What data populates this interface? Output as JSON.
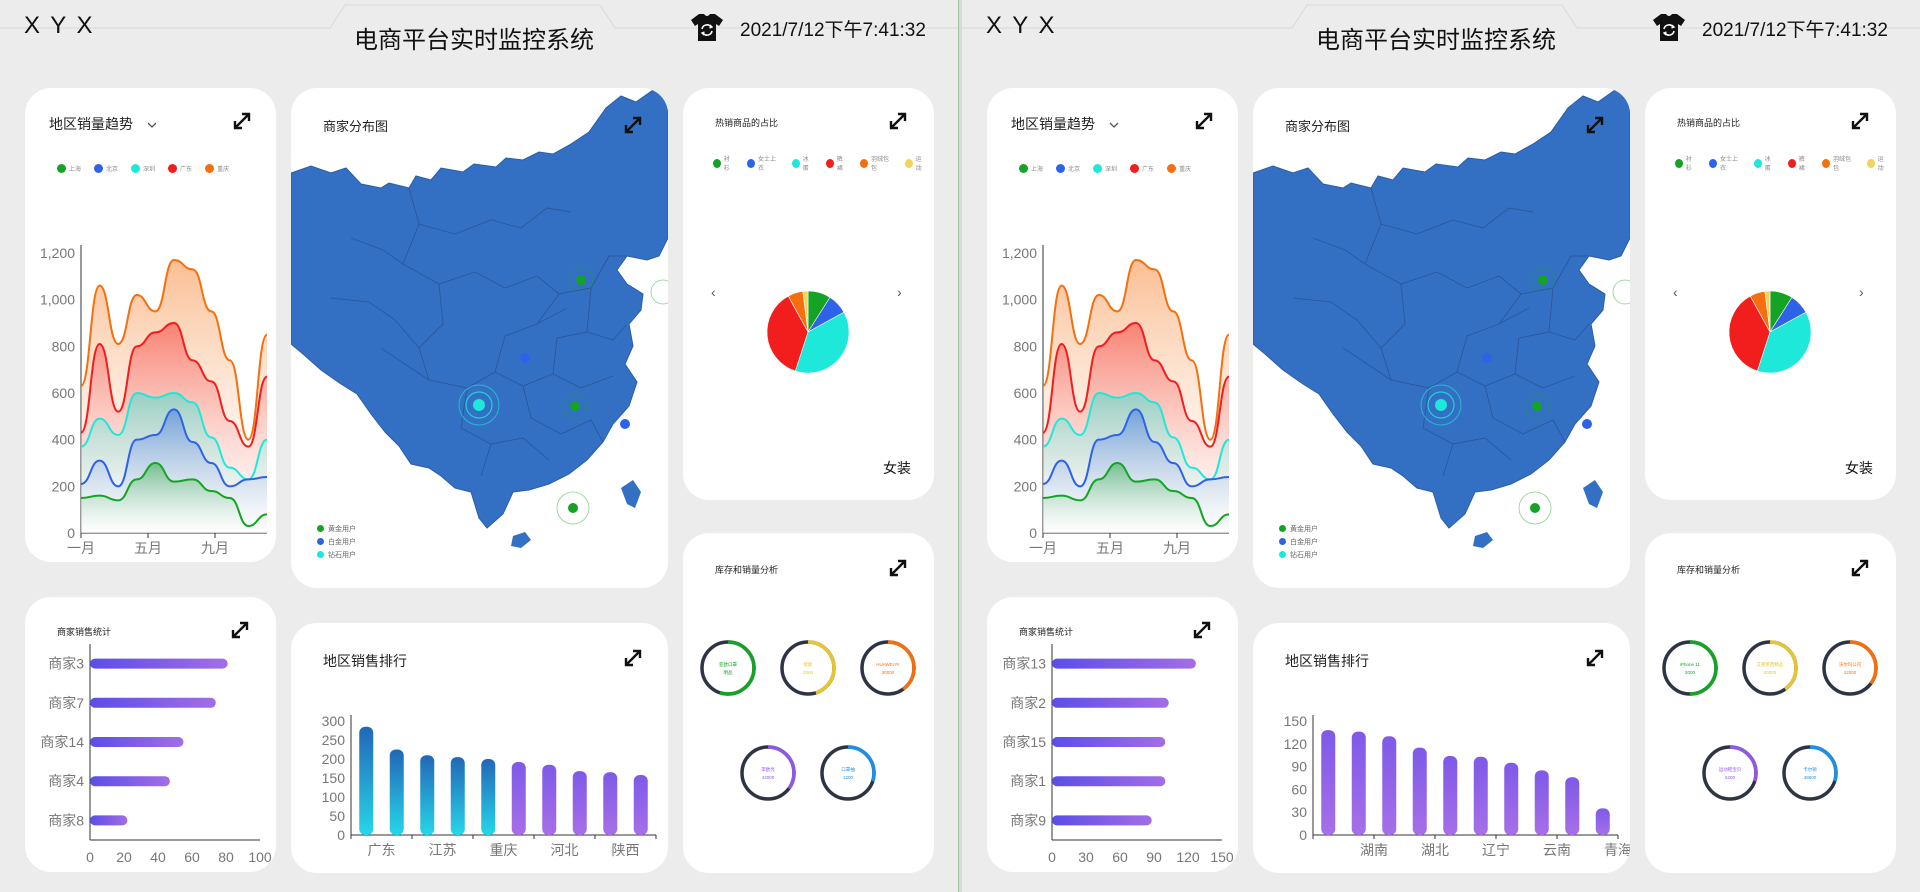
{
  "colors": {
    "green": "#14a324",
    "blue": "#2d62e9",
    "cyan": "#1ee8da",
    "red": "#f21d1d",
    "orange": "#f56f0f",
    "yellow": "#f2d35d",
    "map": "#3370c4"
  },
  "panels": [
    {
      "header": {
        "logo": "X Y X",
        "title": "电商平台实时监控系统",
        "time": "2021/7/12下午7:41:32"
      },
      "trend": {
        "title": "地区销量趋势",
        "legend": [
          "上海",
          "北京",
          "深圳",
          "广东",
          "重庆"
        ],
        "chart_data": {
          "type": "area",
          "y_ticks": [
            "1,200",
            "1,000",
            "800",
            "600",
            "400",
            "200",
            "0"
          ],
          "x_ticks": [
            "一月",
            "五月",
            "九月"
          ],
          "ylim": [
            0,
            1200
          ],
          "series": [
            {
              "name": "上海",
              "values": [
                150,
                160,
                140,
                230,
                300,
                220,
                230,
                180,
                150,
                30,
                80
              ]
            },
            {
              "name": "北京",
              "values": [
                210,
                310,
                200,
                400,
                420,
                530,
                390,
                300,
                200,
                230,
                240
              ]
            },
            {
              "name": "深圳",
              "values": [
                370,
                490,
                420,
                600,
                580,
                600,
                560,
                410,
                280,
                230,
                400
              ]
            },
            {
              "name": "广东",
              "values": [
                430,
                810,
                520,
                800,
                860,
                900,
                740,
                650,
                480,
                370,
                670
              ]
            },
            {
              "name": "重庆",
              "values": [
                630,
                1060,
                810,
                1020,
                950,
                1170,
                1130,
                950,
                740,
                400,
                850
              ]
            }
          ]
        }
      },
      "merchant_map": {
        "title": "商家分布图",
        "legend": [
          "黄金用户",
          "白金用户",
          "钻石用户"
        ]
      },
      "hot": {
        "title": "热销商品的占比",
        "legend": [
          "衬衫",
          "女士上衣",
          "冰蛋",
          "裤裙",
          "羽绒包包",
          "运动"
        ],
        "caption": "女装",
        "chart_data": {
          "type": "pie",
          "values": [
            {
              "value": 9,
              "color": "#14a324"
            },
            {
              "value": 8,
              "color": "#2d62e9"
            },
            {
              "value": 38,
              "color": "#1ee8da"
            },
            {
              "value": 37,
              "color": "#f21d1d"
            },
            {
              "value": 6,
              "color": "#f56f0f"
            },
            {
              "value": 2,
              "color": "#f2d35d"
            }
          ]
        }
      },
      "merchant_sales": {
        "title": "商家销售统计",
        "chart_data": {
          "type": "bar",
          "categories": [
            "商家3",
            "商家7",
            "商家14",
            "商家4",
            "商家8"
          ],
          "values": [
            81,
            74,
            55,
            47,
            22
          ],
          "x_ticks": [
            "0",
            "20",
            "40",
            "60",
            "80",
            "100"
          ],
          "xlim": [
            0,
            100
          ]
        }
      },
      "region_rank": {
        "title": "地区销售排行",
        "chart_data": {
          "type": "bar",
          "categories": [
            "广东",
            "",
            "江苏",
            "",
            "重庆",
            "",
            "河北",
            "",
            "陕西",
            ""
          ],
          "x_labels": [
            "广东",
            "江苏",
            "重庆",
            "河北",
            "陕西"
          ],
          "values": [
            285,
            225,
            210,
            205,
            200,
            192,
            185,
            168,
            165,
            158
          ],
          "y_ticks": [
            "300",
            "250",
            "200",
            "150",
            "100",
            "50",
            "0"
          ],
          "ylim": [
            0,
            300
          ]
        }
      },
      "stock": {
        "title": "库存和销量分析",
        "rings": [
          {
            "l1": "亚欧口罩",
            "l2": "明品",
            "color": "#14a324",
            "v": 0.55
          },
          {
            "l1": "智能",
            "l2": "2000",
            "color": "#e7c433",
            "v": 0.45
          },
          {
            "l1": "HUAWEI Pr",
            "l2": "30000",
            "color": "#f56f0f",
            "v": 0.4
          },
          {
            "l1": "李欧亮",
            "l2": "42000",
            "color": "#8f58e8",
            "v": 0.35
          },
          {
            "l1": "口罩抽",
            "l2": "1200",
            "color": "#1d8fe8",
            "v": 0.3
          }
        ]
      }
    },
    {
      "header": {
        "logo": "X Y X",
        "title": "电商平台实时监控系统",
        "time": "2021/7/12下午7:41:32"
      },
      "trend": {
        "title": "地区销量趋势",
        "legend": [
          "上海",
          "北京",
          "深圳",
          "广东",
          "重庆"
        ],
        "chart_data": {
          "type": "area",
          "y_ticks": [
            "1,200",
            "1,000",
            "800",
            "600",
            "400",
            "200",
            "0"
          ],
          "x_ticks": [
            "一月",
            "五月",
            "九月"
          ],
          "ylim": [
            0,
            1200
          ],
          "series": [
            {
              "name": "上海",
              "values": [
                150,
                160,
                140,
                230,
                300,
                220,
                230,
                180,
                150,
                30,
                80
              ]
            },
            {
              "name": "北京",
              "values": [
                210,
                310,
                200,
                400,
                420,
                530,
                390,
                300,
                200,
                230,
                240
              ]
            },
            {
              "name": "深圳",
              "values": [
                370,
                490,
                420,
                600,
                580,
                600,
                560,
                410,
                280,
                230,
                400
              ]
            },
            {
              "name": "广东",
              "values": [
                430,
                810,
                520,
                800,
                860,
                900,
                740,
                650,
                480,
                370,
                670
              ]
            },
            {
              "name": "重庆",
              "values": [
                630,
                1060,
                810,
                1020,
                950,
                1170,
                1130,
                950,
                740,
                400,
                850
              ]
            }
          ]
        }
      },
      "merchant_map": {
        "title": "商家分布图",
        "legend": [
          "黄金用户",
          "白金用户",
          "钻石用户"
        ]
      },
      "hot": {
        "title": "热销商品的占比",
        "legend": [
          "衬衫",
          "女士上衣",
          "冰蛋",
          "裤裙",
          "羽绒包包",
          "运动"
        ],
        "caption": "女装",
        "chart_data": {
          "type": "pie",
          "values": [
            {
              "value": 9,
              "color": "#14a324"
            },
            {
              "value": 8,
              "color": "#2d62e9"
            },
            {
              "value": 38,
              "color": "#1ee8da"
            },
            {
              "value": 37,
              "color": "#f21d1d"
            },
            {
              "value": 6,
              "color": "#f56f0f"
            },
            {
              "value": 2,
              "color": "#f2d35d"
            }
          ]
        }
      },
      "merchant_sales": {
        "title": "商家销售统计",
        "chart_data": {
          "type": "bar",
          "categories": [
            "商家13",
            "商家2",
            "商家15",
            "商家1",
            "商家9"
          ],
          "values": [
            127,
            103,
            100,
            100,
            88
          ],
          "x_ticks": [
            "0",
            "30",
            "60",
            "90",
            "120",
            "150"
          ],
          "xlim": [
            0,
            150
          ]
        }
      },
      "region_rank": {
        "title": "地区销售排行",
        "chart_data": {
          "type": "bar",
          "categories": [
            "",
            "湖南",
            "",
            "湖北",
            "",
            "辽宁",
            "",
            "云南",
            "",
            "青海"
          ],
          "x_labels": [
            "湖南",
            "湖北",
            "辽宁",
            "云南",
            "青海"
          ],
          "values": [
            138,
            136,
            130,
            115,
            104,
            103,
            95,
            85,
            76,
            35
          ],
          "y_ticks": [
            "150",
            "120",
            "90",
            "60",
            "30",
            "0"
          ],
          "ylim": [
            0,
            150
          ]
        }
      },
      "stock": {
        "title": "库存和销量分析",
        "rings": [
          {
            "l1": "iPhone 11",
            "l2": "2000",
            "color": "#14a324",
            "v": 0.5
          },
          {
            "l1": "艾德莱西精品",
            "l2": "20000",
            "color": "#e7c433",
            "v": 0.4
          },
          {
            "l1": "沃尔玛公司",
            "l2": "12000",
            "color": "#f56f0f",
            "v": 0.35
          },
          {
            "l1": "运动鞋宝贝",
            "l2": "5200",
            "color": "#8f58e8",
            "v": 0.3
          },
          {
            "l1": "卡尔顿",
            "l2": "48600",
            "color": "#1d8fe8",
            "v": 0.3
          }
        ]
      }
    }
  ]
}
